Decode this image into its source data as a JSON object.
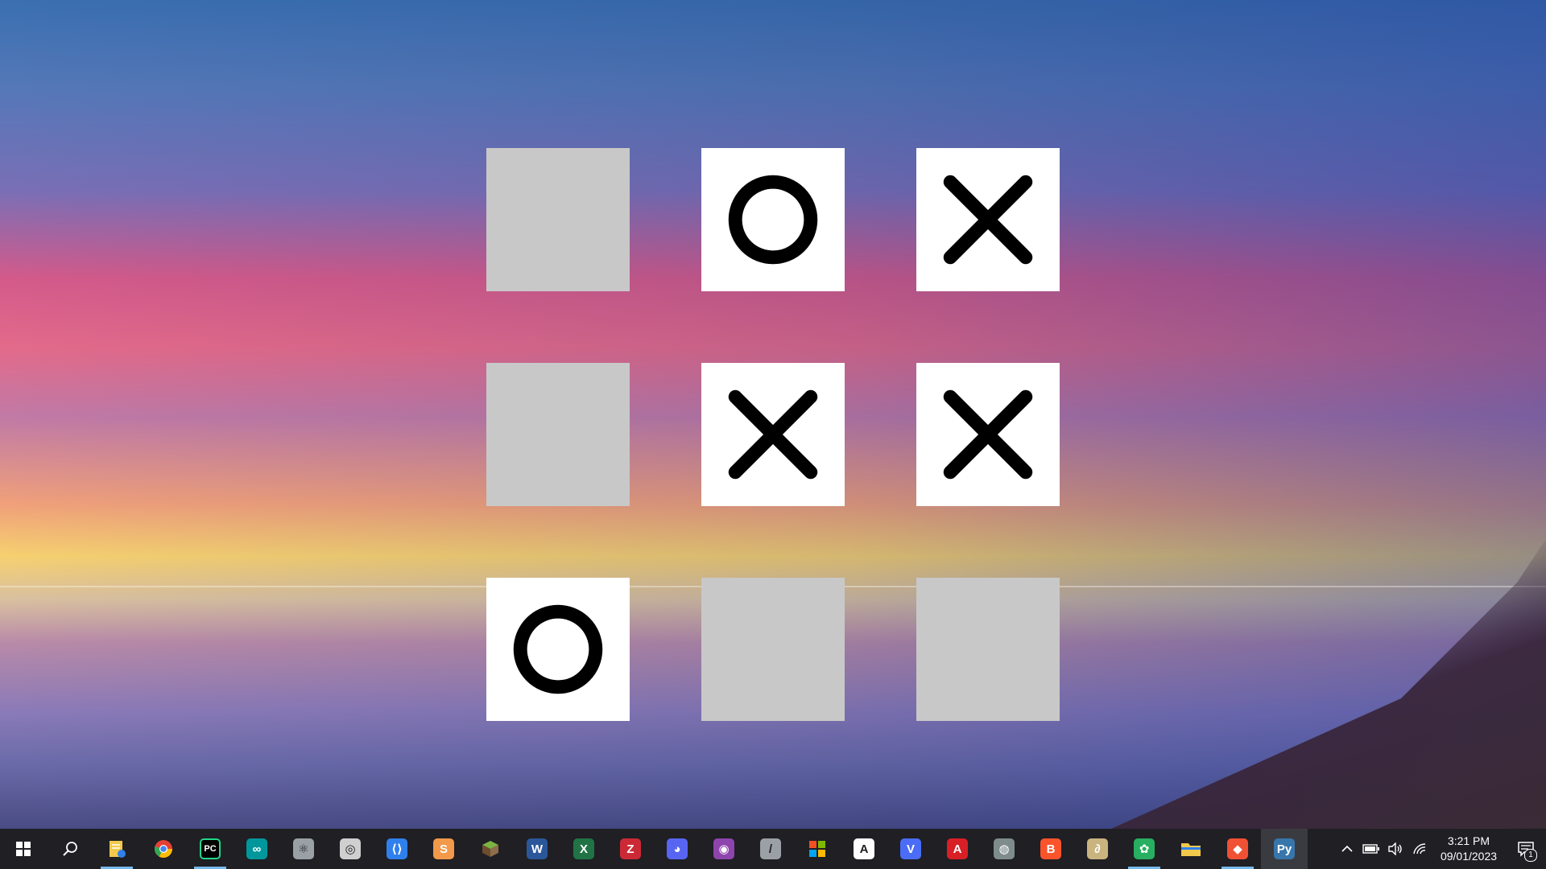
{
  "board": {
    "cells": [
      "",
      "O",
      "X",
      "",
      "X",
      "X",
      "O",
      "",
      ""
    ]
  },
  "taskbar": {
    "apps": [
      {
        "name": "start-button",
        "icon": "windows-icon",
        "color": "#ffffff",
        "letter": ""
      },
      {
        "name": "search-button",
        "icon": "search-icon",
        "color": "#ffffff",
        "letter": ""
      },
      {
        "name": "app-1",
        "icon": "notepad-icon",
        "color": "#f2c94c",
        "letter": ""
      },
      {
        "name": "app-2",
        "icon": "chrome-icon",
        "color": "#e44134",
        "letter": ""
      },
      {
        "name": "app-3",
        "icon": "pycharm-icon",
        "color": "#21d789",
        "letter": "PC"
      },
      {
        "name": "app-4",
        "icon": "arduino-icon",
        "color": "#00979c",
        "letter": "∞"
      },
      {
        "name": "app-5",
        "icon": "atom-icon",
        "color": "#9aa0a6",
        "letter": "⚛"
      },
      {
        "name": "app-6",
        "icon": "obs-icon",
        "color": "#cfcfcf",
        "letter": "◎"
      },
      {
        "name": "app-7",
        "icon": "vscode-icon",
        "color": "#2f80ed",
        "letter": "⟨⟩"
      },
      {
        "name": "app-8",
        "icon": "sublime-icon",
        "color": "#f2994a",
        "letter": "S"
      },
      {
        "name": "app-9",
        "icon": "minecraft-icon",
        "color": "#5f8f3a",
        "letter": ""
      },
      {
        "name": "app-10",
        "icon": "word-icon",
        "color": "#2b579a",
        "letter": "W"
      },
      {
        "name": "app-11",
        "icon": "excel-icon",
        "color": "#217346",
        "letter": "X"
      },
      {
        "name": "app-12",
        "icon": "zotero-icon",
        "color": "#cc2936",
        "letter": "Z"
      },
      {
        "name": "app-13",
        "icon": "discord-icon",
        "color": "#5865f2",
        "letter": "◕"
      },
      {
        "name": "app-14",
        "icon": "podcast-icon",
        "color": "#8e44ad",
        "letter": "◉"
      },
      {
        "name": "app-15",
        "icon": "tool-icon",
        "color": "#9aa0a6",
        "letter": "/"
      },
      {
        "name": "app-16",
        "icon": "microsoft-store-icon",
        "color": "#f25022",
        "letter": ""
      },
      {
        "name": "app-17",
        "icon": "app-circle-icon",
        "color": "#ffffff",
        "letter": "A"
      },
      {
        "name": "app-18",
        "icon": "v4-icon",
        "color": "#4a6cf7",
        "letter": "V"
      },
      {
        "name": "app-19",
        "icon": "acrobat-icon",
        "color": "#d81f26",
        "letter": "A"
      },
      {
        "name": "app-20",
        "icon": "globe-app-icon",
        "color": "#7f8c8d",
        "letter": "◍"
      },
      {
        "name": "app-21",
        "icon": "brave-icon",
        "color": "#fb542b",
        "letter": "B"
      },
      {
        "name": "app-22",
        "icon": "vpn-icon",
        "color": "#c9b37e",
        "letter": "∂"
      },
      {
        "name": "app-23",
        "icon": "colorful-app-icon",
        "color": "#27ae60",
        "letter": "✿"
      },
      {
        "name": "app-24",
        "icon": "file-explorer-icon",
        "color": "#f2c94c",
        "letter": ""
      },
      {
        "name": "app-25",
        "icon": "git-icon",
        "color": "#f05033",
        "letter": "◆"
      },
      {
        "name": "app-26",
        "icon": "python-icon",
        "color": "#3776ab",
        "letter": "Py"
      }
    ],
    "tray": {
      "icons": [
        "chevron-up-icon",
        "battery-icon",
        "volume-icon",
        "wifi-icon"
      ],
      "time": "3:21 PM",
      "date": "09/01/2023",
      "notification_count": "1"
    }
  }
}
